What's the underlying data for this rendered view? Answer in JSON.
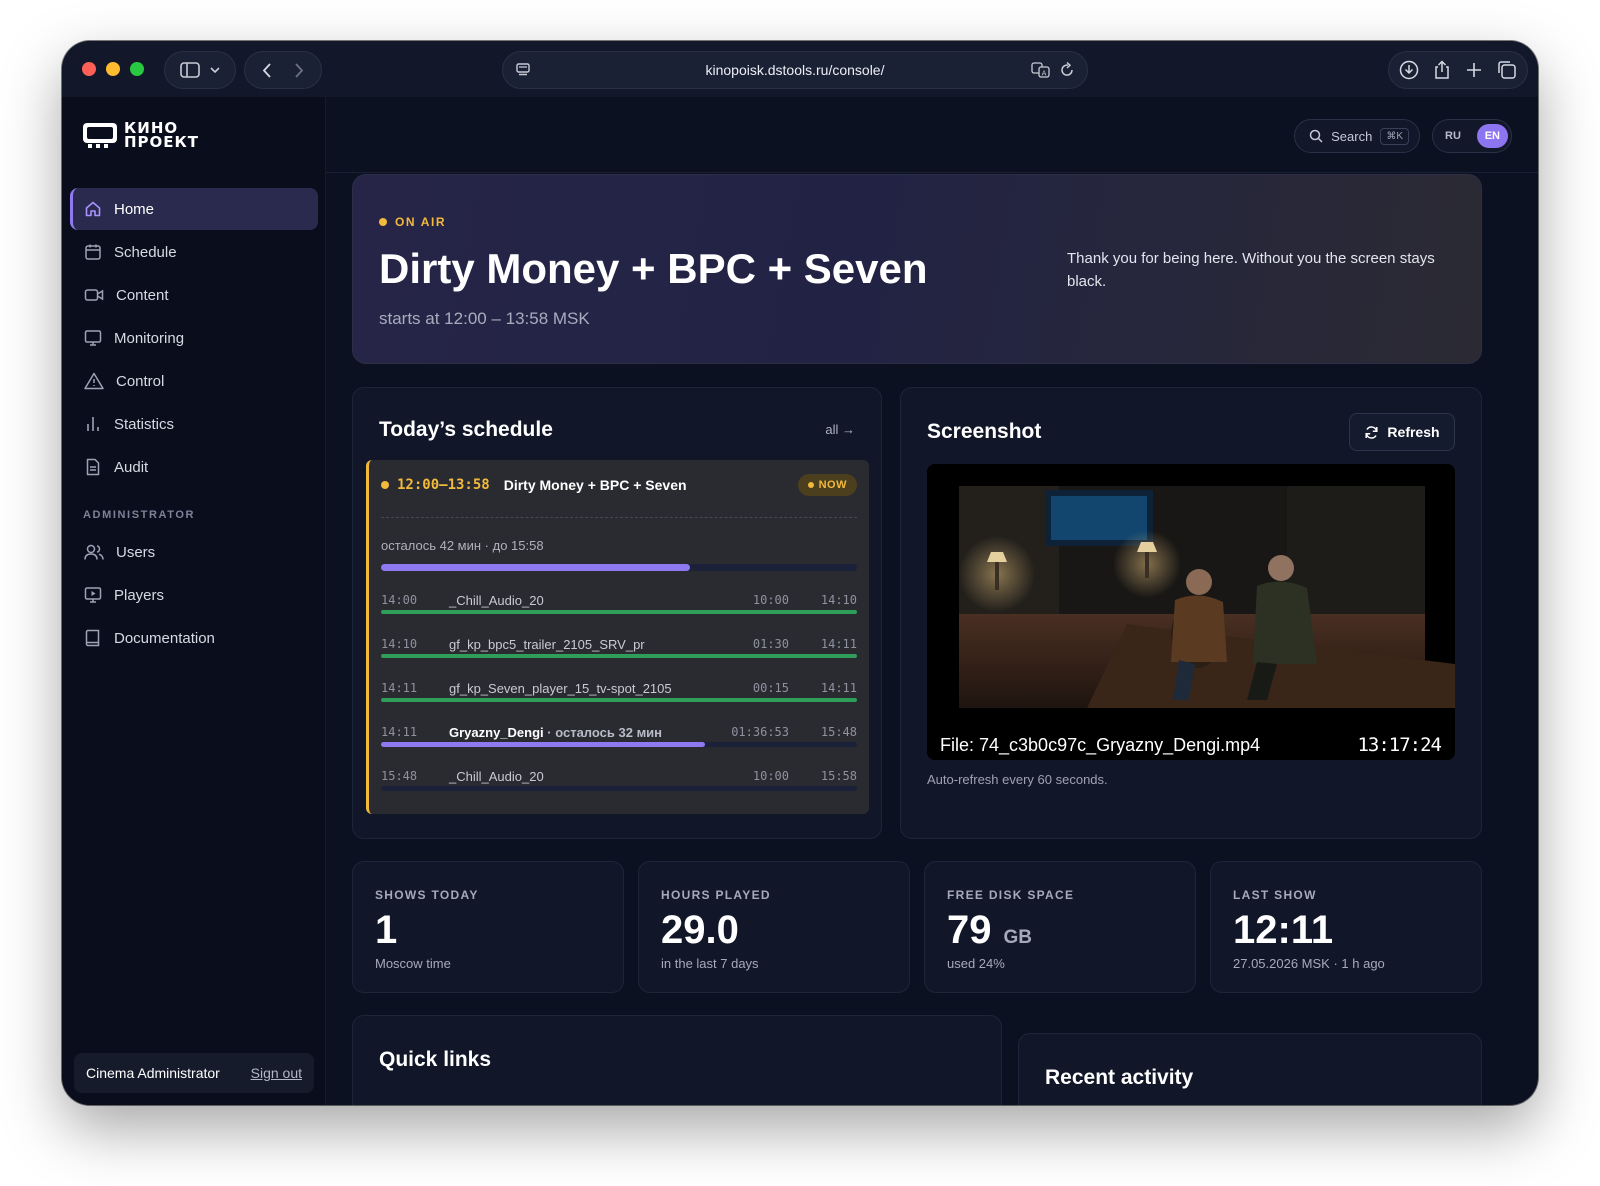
{
  "browser": {
    "url": "kinopoisk.dstools.ru/console/"
  },
  "logo": {
    "line1": "КИНО",
    "line2": "ПРОЕКТ"
  },
  "sidebar": {
    "items": [
      {
        "label": "Home",
        "icon": "home-icon"
      },
      {
        "label": "Schedule",
        "icon": "calendar-icon"
      },
      {
        "label": "Content",
        "icon": "video-icon"
      },
      {
        "label": "Monitoring",
        "icon": "monitor-icon"
      },
      {
        "label": "Control",
        "icon": "warning-icon"
      },
      {
        "label": "Statistics",
        "icon": "bar-chart-icon"
      },
      {
        "label": "Audit",
        "icon": "document-icon"
      }
    ],
    "admin_section": "ADMINISTRATOR",
    "admin_items": [
      {
        "label": "Users",
        "icon": "users-icon"
      },
      {
        "label": "Players",
        "icon": "player-icon"
      },
      {
        "label": "Documentation",
        "icon": "book-icon"
      }
    ],
    "user": {
      "name": "Cinema Administrator",
      "signout": "Sign out"
    }
  },
  "topbar": {
    "search_label": "Search",
    "search_shortcut": "⌘K",
    "lang_ru": "RU",
    "lang_en": "EN"
  },
  "hero": {
    "status": "ON AIR",
    "title": "Dirty Money + BPC + Seven",
    "subtitle": "starts at 12:00 – 13:58 MSK",
    "note": "Thank you for being here. Without you the screen stays black."
  },
  "schedule": {
    "title": "Today’s schedule",
    "all_link": "all →",
    "current": {
      "time": "12:00–13:58",
      "title": "Dirty Money + BPC + Seven",
      "badge": "NOW",
      "remaining": "осталось 42 мин · до 15:58",
      "progress": 0.65
    },
    "rows": [
      {
        "start": "14:00",
        "name": "_Chill_Audio_20",
        "extra": "",
        "duration": "10:00",
        "end": "14:10",
        "progress": 1.0,
        "color": "#2f9e5a"
      },
      {
        "start": "14:10",
        "name": "gf_kp_bpc5_trailer_2105_SRV_pr",
        "extra": "",
        "duration": "01:30",
        "end": "14:11",
        "progress": 1.0,
        "color": "#2f9e5a"
      },
      {
        "start": "14:11",
        "name": "gf_kp_Seven_player_15_tv-spot_2105",
        "extra": "",
        "duration": "00:15",
        "end": "14:11",
        "progress": 1.0,
        "color": "#2f9e5a"
      },
      {
        "start": "14:11",
        "name": "Gryazny_Dengi",
        "extra": " · осталось 32 мин",
        "duration": "01:36:53",
        "end": "15:48",
        "progress": 0.68,
        "color": "#8f79f0"
      },
      {
        "start": "15:48",
        "name": "_Chill_Audio_20",
        "extra": "",
        "duration": "10:00",
        "end": "15:58",
        "progress": 0.0,
        "color": "#8f79f0"
      }
    ]
  },
  "screenshot": {
    "title": "Screenshot",
    "refresh_label": "Refresh",
    "file_label": "File: 74_c3b0c97c_Gryazny_Dengi.mp4",
    "timecode": "13:17:24",
    "auto_refresh": "Auto-refresh every 60 seconds."
  },
  "stats": [
    {
      "label": "SHOWS TODAY",
      "value": "1",
      "unit": "",
      "sub": "Moscow time"
    },
    {
      "label": "HOURS PLAYED",
      "value": "29.0",
      "unit": "",
      "sub": "in the last 7 days"
    },
    {
      "label": "FREE DISK SPACE",
      "value": "79",
      "unit": "GB",
      "sub": "used 24%"
    },
    {
      "label": "LAST SHOW",
      "value": "12:11",
      "unit": "",
      "sub": "27.05.2026 MSK · 1 h ago"
    }
  ],
  "quick_links": {
    "title": "Quick links"
  },
  "recent_activity": {
    "title": "Recent activity"
  },
  "colors": {
    "accent": "#8f79f0",
    "on_air": "#f2b93b",
    "done": "#2f9e5a"
  }
}
